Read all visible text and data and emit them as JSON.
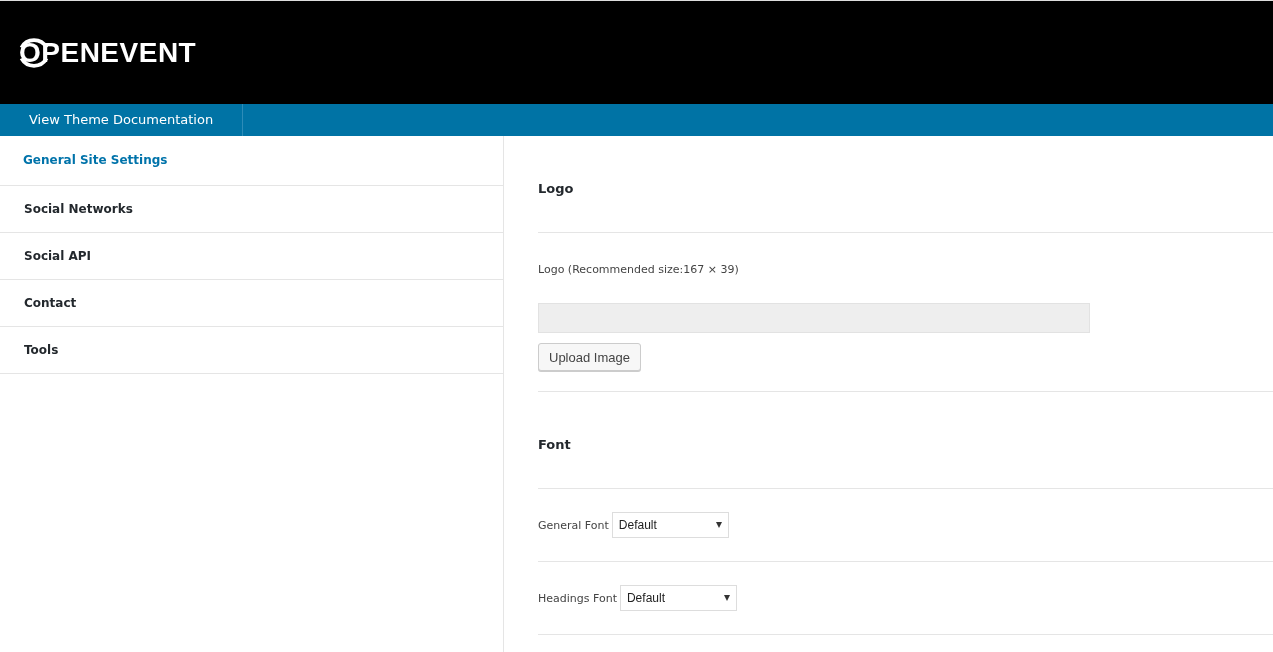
{
  "header": {
    "logo_text": "OPENEVENT"
  },
  "toolbar": {
    "items": [
      {
        "label": "View Theme Documentation"
      }
    ]
  },
  "sidebar": {
    "items": [
      {
        "label": "General Site Settings",
        "selected": true
      },
      {
        "label": "Social Networks",
        "selected": false
      },
      {
        "label": "Social API",
        "selected": false
      },
      {
        "label": "Contact",
        "selected": false
      },
      {
        "label": "Tools",
        "selected": false
      }
    ]
  },
  "sections": [
    {
      "heading": "Logo",
      "fields": [
        {
          "kind": "image",
          "label": "Logo (Recommended size:167 × 39)",
          "button": "Upload Image"
        }
      ]
    },
    {
      "heading": "Font",
      "fields": [
        {
          "kind": "select",
          "label": "General Font",
          "value": "Default"
        },
        {
          "kind": "select",
          "label": "Headings Font",
          "value": "Default"
        }
      ]
    }
  ]
}
